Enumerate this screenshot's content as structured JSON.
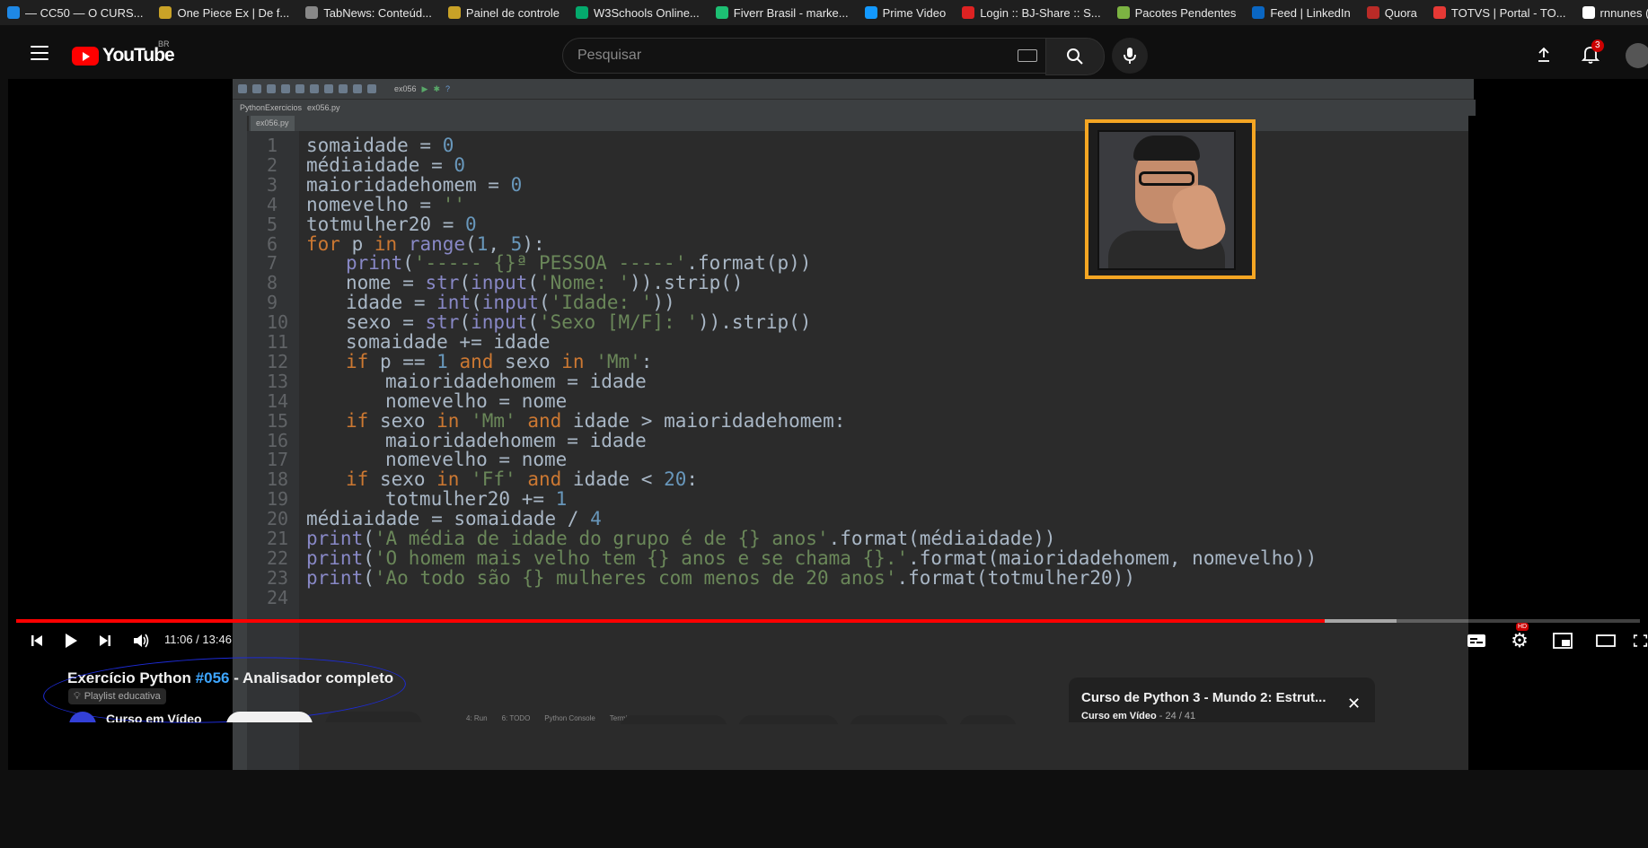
{
  "bookmarks": [
    {
      "label": "— CC50 — O CURS...",
      "icon": "p-icon",
      "color": "#1e88e5"
    },
    {
      "label": "One Piece Ex | De f...",
      "icon": "pirate-icon",
      "color": "#c9a227"
    },
    {
      "label": "TabNews: Conteúd...",
      "icon": "square-icon",
      "color": "#888888"
    },
    {
      "label": "Painel de controle",
      "icon": "arrow-icon",
      "color": "#c9a227"
    },
    {
      "label": "W3Schools Online...",
      "icon": "w3-icon",
      "color": "#04aa6d"
    },
    {
      "label": "Fiverr Brasil - marke...",
      "icon": "fiverr-icon",
      "color": "#1dbf73"
    },
    {
      "label": "Prime Video",
      "icon": "prime-icon",
      "color": "#1399ff"
    },
    {
      "label": "Login :: BJ-Share :: S...",
      "icon": "bj-icon",
      "color": "#d22"
    },
    {
      "label": "Pacotes Pendentes",
      "icon": "package-icon",
      "color": "#7cb342"
    },
    {
      "label": "Feed | LinkedIn",
      "icon": "linkedin-icon",
      "color": "#0a66c2"
    },
    {
      "label": "Quora",
      "icon": "quora-icon",
      "color": "#b92b27"
    },
    {
      "label": "TOTVS | Portal - TO...",
      "icon": "totvs-icon",
      "color": "#e53935"
    },
    {
      "label": "rnnunes (Rian Nunes)",
      "icon": "github-icon",
      "color": "#ffffff"
    }
  ],
  "header": {
    "logo_text": "YouTube",
    "country": "BR",
    "search_placeholder": "Pesquisar",
    "notifications": "3"
  },
  "ide": {
    "project": "PythonExercicios",
    "file": "ex056.py",
    "run_config": "ex056",
    "status_items": [
      "4: Run",
      "6: TODO",
      "Python Console",
      "Terminal"
    ]
  },
  "code_lines": [
    {
      "n": "1"
    },
    {
      "n": "2"
    },
    {
      "n": "3"
    },
    {
      "n": "4"
    },
    {
      "n": "5"
    },
    {
      "n": "6"
    },
    {
      "n": "7"
    },
    {
      "n": "8"
    },
    {
      "n": "9"
    },
    {
      "n": "10"
    },
    {
      "n": "11"
    },
    {
      "n": "12"
    },
    {
      "n": "13"
    },
    {
      "n": "14"
    },
    {
      "n": "15"
    },
    {
      "n": "16"
    },
    {
      "n": "17"
    },
    {
      "n": "18"
    },
    {
      "n": "19"
    },
    {
      "n": "20"
    },
    {
      "n": "21"
    },
    {
      "n": "22"
    },
    {
      "n": "23"
    },
    {
      "n": "24"
    }
  ],
  "player": {
    "time": "11:06 / 13:46",
    "progress_fraction": 0.806,
    "loaded_fraction": 0.85
  },
  "video": {
    "title_prefix": "Exercício Python ",
    "hashtag": "#056",
    "title_suffix": " - Analisador completo",
    "chip": "Playlist educativa",
    "channel": "Curso em Vídeo"
  },
  "playlist": {
    "title": "Curso de Python 3 - Mundo 2: Estrut...",
    "channel": "Curso em Vídeo",
    "position": " - 24 / 41"
  }
}
